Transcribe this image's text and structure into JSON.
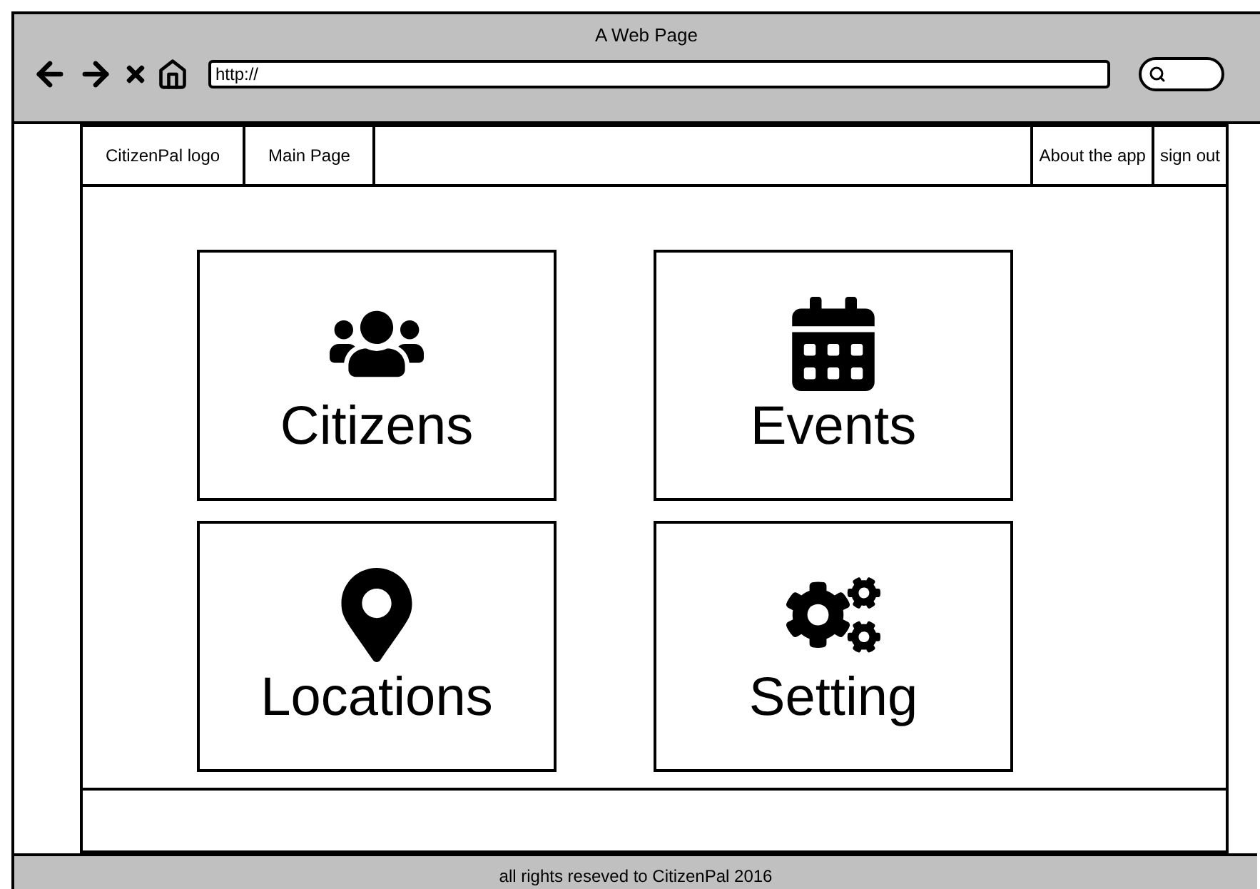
{
  "window": {
    "title": "A Web Page"
  },
  "address_bar": {
    "value": "http://"
  },
  "nav": {
    "left": [
      {
        "label": "CitizenPal logo"
      },
      {
        "label": "Main Page"
      }
    ],
    "right": [
      {
        "label": "About the app"
      },
      {
        "label": "sign out"
      }
    ]
  },
  "tiles": [
    {
      "label": "Citizens"
    },
    {
      "label": "Events"
    },
    {
      "label": "Locations"
    },
    {
      "label": "Setting"
    }
  ],
  "status_bar": {
    "text": "all rights reseved to CitizenPal 2016"
  }
}
